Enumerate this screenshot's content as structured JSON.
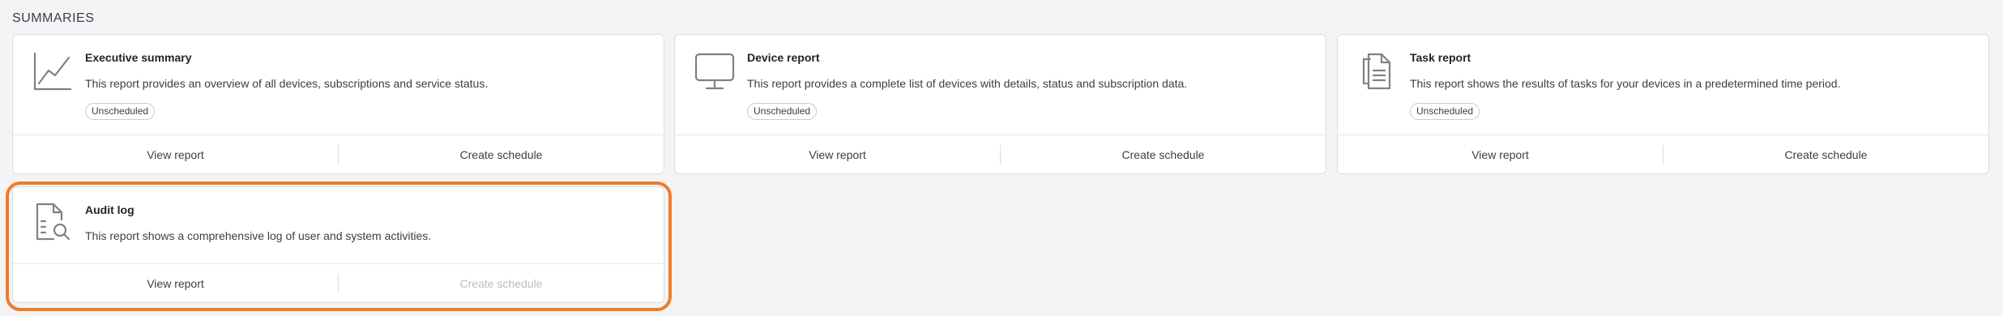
{
  "section": {
    "title": "SUMMARIES"
  },
  "cards": [
    {
      "icon": "line-chart-icon",
      "title": "Executive summary",
      "description": "This report provides an overview of all devices, subscriptions and service status.",
      "badge": "Unscheduled",
      "view_label": "View report",
      "schedule_label": "Create schedule",
      "schedule_enabled": true
    },
    {
      "icon": "monitor-icon",
      "title": "Device report",
      "description": "This report provides a complete list of devices with details, status and subscription data.",
      "badge": "Unscheduled",
      "view_label": "View report",
      "schedule_label": "Create schedule",
      "schedule_enabled": true
    },
    {
      "icon": "documents-icon",
      "title": "Task report",
      "description": "This report shows the results of tasks for your devices in a predetermined time period.",
      "badge": "Unscheduled",
      "view_label": "View report",
      "schedule_label": "Create schedule",
      "schedule_enabled": true
    },
    {
      "icon": "document-search-icon",
      "title": "Audit log",
      "description": "This report shows a comprehensive log of user and system activities.",
      "view_label": "View report",
      "schedule_label": "Create schedule",
      "schedule_enabled": false
    }
  ],
  "colors": {
    "highlight": "#f07c26",
    "icon": "#7d8288",
    "disabled_text": "#b9bcc1"
  }
}
